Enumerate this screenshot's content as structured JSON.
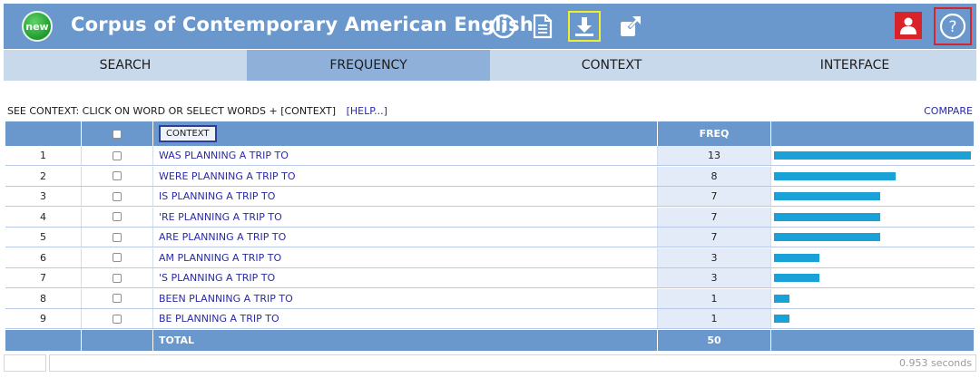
{
  "header": {
    "logo_text": "new",
    "title": "Corpus of Contemporary American English",
    "icons": [
      "info-icon",
      "document-icon",
      "download-icon",
      "external-link-icon",
      "user-icon",
      "help-icon"
    ]
  },
  "tabs": [
    {
      "label": "SEARCH",
      "active": false
    },
    {
      "label": "FREQUENCY",
      "active": true
    },
    {
      "label": "CONTEXT",
      "active": false
    },
    {
      "label": "INTERFACE",
      "active": false
    }
  ],
  "instructions": {
    "text": "SEE CONTEXT: CLICK ON WORD OR SELECT WORDS + [CONTEXT]",
    "help_link": "[HELP...]",
    "compare_link": "COMPARE"
  },
  "table": {
    "context_button": "CONTEXT",
    "freq_header": "FREQ",
    "max_freq": 13,
    "rows": [
      {
        "num": "1",
        "phrase": "WAS PLANNING A TRIP TO",
        "freq": 13
      },
      {
        "num": "2",
        "phrase": "WERE PLANNING A TRIP TO",
        "freq": 8
      },
      {
        "num": "3",
        "phrase": "IS PLANNING A TRIP TO",
        "freq": 7
      },
      {
        "num": "4",
        "phrase": "'RE PLANNING A TRIP TO",
        "freq": 7
      },
      {
        "num": "5",
        "phrase": "ARE PLANNING A TRIP TO",
        "freq": 7
      },
      {
        "num": "6",
        "phrase": "AM PLANNING A TRIP TO",
        "freq": 3
      },
      {
        "num": "7",
        "phrase": "'S PLANNING A TRIP TO",
        "freq": 3
      },
      {
        "num": "8",
        "phrase": "BEEN PLANNING A TRIP TO",
        "freq": 1
      },
      {
        "num": "9",
        "phrase": "BE PLANNING A TRIP TO",
        "freq": 1
      }
    ],
    "total_label": "TOTAL",
    "total_value": "50"
  },
  "footer": {
    "timing": "0.953 seconds"
  },
  "colors": {
    "header_bg": "#6b98cc",
    "tab_bg": "#c9d9ec",
    "tab_active_bg": "#8fb0d9",
    "bar": "#1aa1d8",
    "link": "#2a2aa8"
  }
}
